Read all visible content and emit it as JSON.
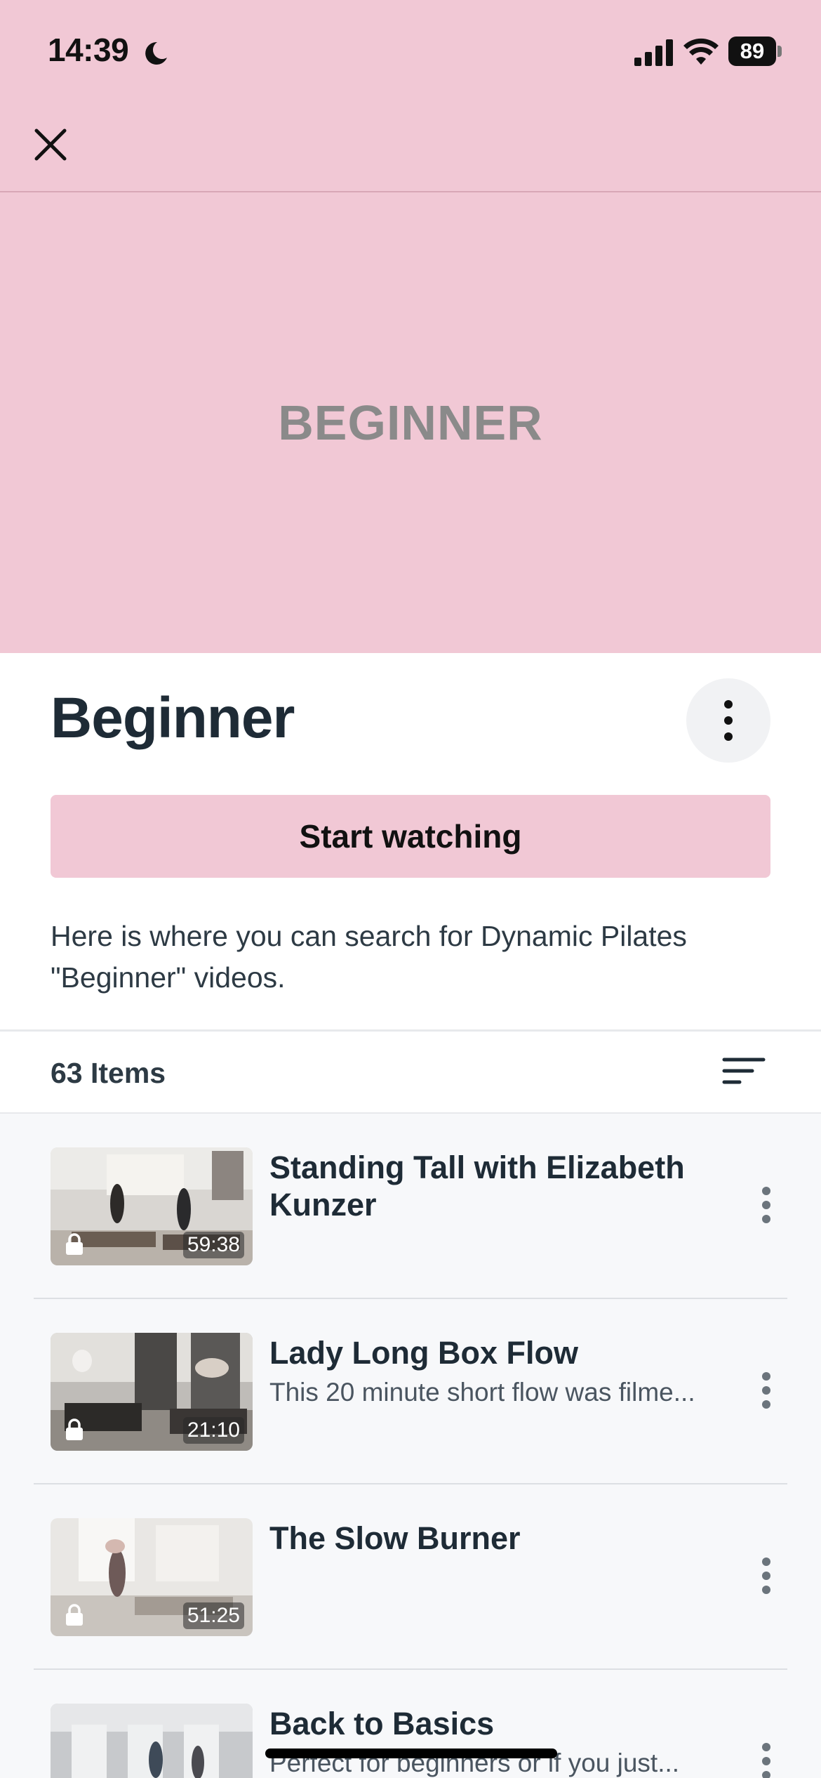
{
  "status_bar": {
    "time": "14:39",
    "battery": "89"
  },
  "banner": {
    "text": "BEGINNER"
  },
  "header": {
    "title": "Beginner",
    "start_label": "Start watching",
    "description": "Here is where you can search for Dynamic Pilates \"Beginner\" videos."
  },
  "items_bar": {
    "count_label": "63 Items"
  },
  "videos": [
    {
      "title": "Standing Tall with Elizabeth Kunzer",
      "subtitle": "",
      "duration": "59:38",
      "locked": true
    },
    {
      "title": "Lady Long Box Flow",
      "subtitle": "This 20 minute short flow was filme...",
      "duration": "21:10",
      "locked": true
    },
    {
      "title": "The Slow Burner",
      "subtitle": "",
      "duration": "51:25",
      "locked": true
    },
    {
      "title": "Back to Basics",
      "subtitle": "Perfect for beginners or if you just...",
      "duration": "",
      "locked": false
    }
  ],
  "colors": {
    "brand_pink": "#f1c8d5",
    "title_text": "#1e2b36",
    "list_background": "#f7f8fa"
  },
  "icons": {
    "close": "close-icon",
    "more": "more-vertical-icon",
    "sort": "sort-icon",
    "lock": "lock-icon"
  }
}
